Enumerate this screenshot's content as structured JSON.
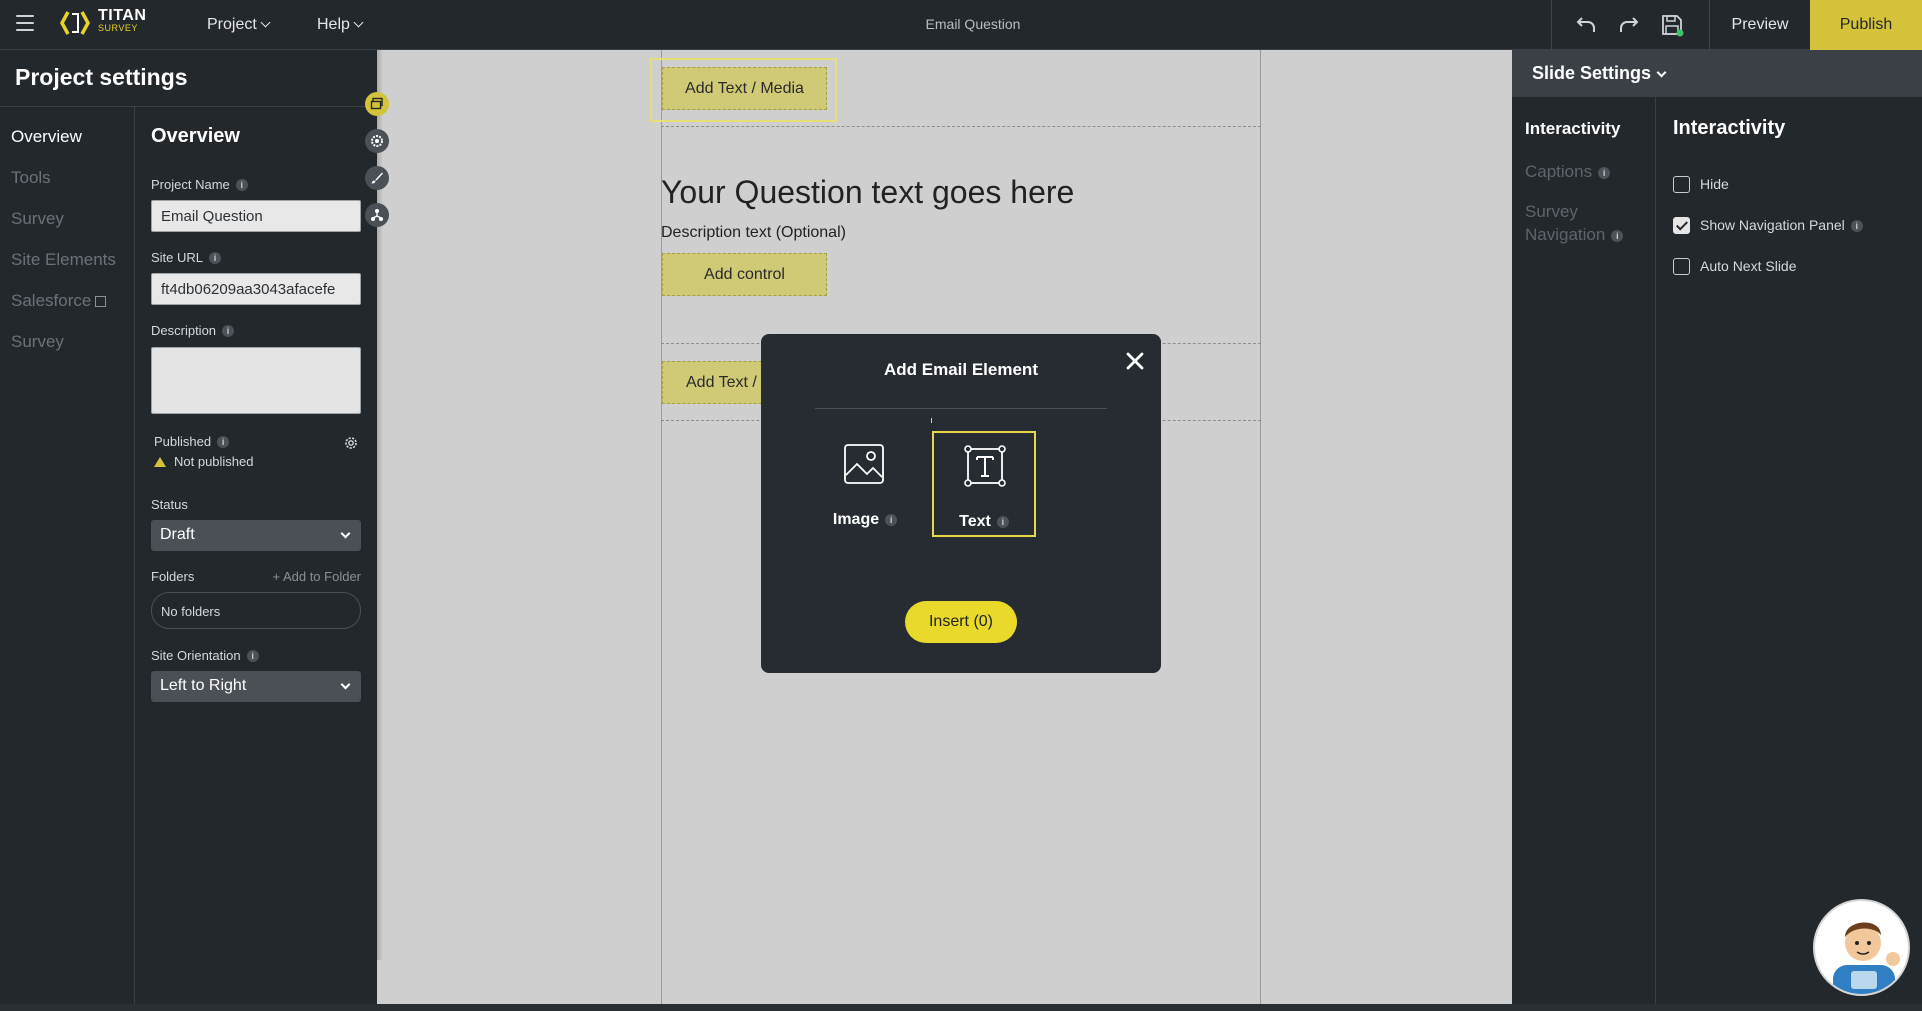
{
  "topbar": {
    "logo_title": "TITAN",
    "logo_subtitle": "SURVEY",
    "menu": [
      {
        "label": "Project"
      },
      {
        "label": "Help"
      }
    ],
    "document_title": "Email Question",
    "preview_label": "Preview",
    "publish_label": "Publish"
  },
  "left_panel": {
    "title": "Project settings",
    "nav": [
      "Overview",
      "Tools",
      "Survey",
      "Site Elements",
      "Salesforce",
      "Survey"
    ],
    "form": {
      "title": "Overview",
      "project_name_label": "Project Name",
      "project_name_value": "Email Question",
      "site_url_label": "Site URL",
      "site_url_value": "ft4db06209aa3043afacefe",
      "description_label": "Description",
      "published_label": "Published",
      "published_status": "Not published",
      "status_label": "Status",
      "status_value": "Draft",
      "folders_label": "Folders",
      "add_to_folder": "+ Add to Folder",
      "folders_value": "No folders",
      "orientation_label": "Site Orientation",
      "orientation_value": "Left to Right"
    }
  },
  "canvas": {
    "add_text_media_label": "Add Text / Media",
    "question_text": "Your Question text goes here",
    "description_text": "Description text (Optional)",
    "add_control_label": "Add control",
    "add_text_partial_label": "Add Text /"
  },
  "modal": {
    "title": "Add Email Element",
    "options": [
      {
        "label": "Image",
        "selected": false
      },
      {
        "label": "Text",
        "selected": true
      }
    ],
    "insert_label": "Insert (0)"
  },
  "right_panel": {
    "title": "Slide Settings",
    "nav": [
      {
        "label": "Interactivity",
        "active": true
      },
      {
        "label": "Captions",
        "active": false
      },
      {
        "label": "Survey Navigation",
        "active": false
      }
    ],
    "content_title": "Interactivity",
    "options": [
      {
        "label": "Hide",
        "checked": false
      },
      {
        "label": "Show Navigation Panel",
        "checked": true
      },
      {
        "label": "Auto Next Slide",
        "checked": false
      }
    ]
  },
  "colors": {
    "accent": "#d4c23a",
    "dark_bg": "#23282d",
    "canvas_bg": "#cfcfcf"
  }
}
